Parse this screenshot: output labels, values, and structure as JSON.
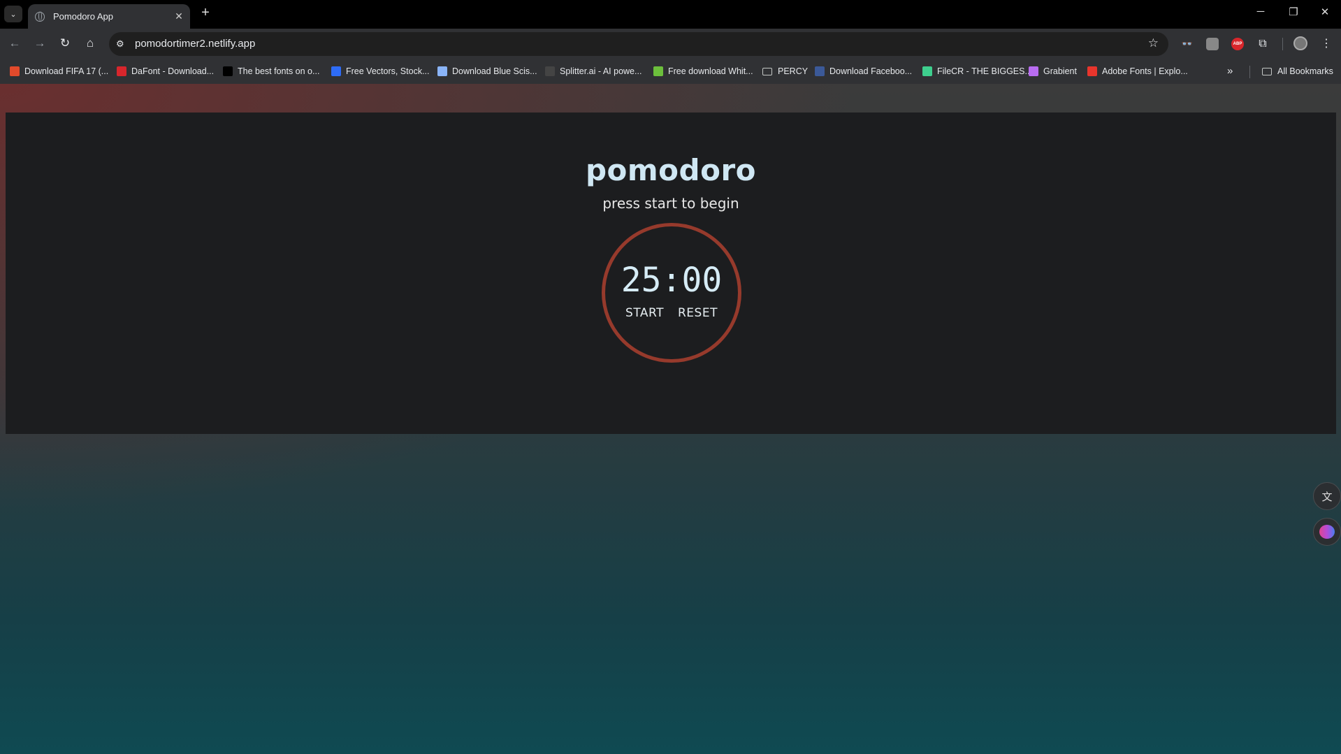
{
  "browser": {
    "tab_title": "Pomodoro App",
    "url": "pomodortimer2.netlify.app",
    "bookmarks": [
      {
        "label": "Download FIFA 17 (...",
        "icon": "x-icon",
        "color": "#e24a2b"
      },
      {
        "label": "DaFont - Download...",
        "icon": "dafont-icon",
        "color": "#d7262c"
      },
      {
        "label": "The best fonts on o...",
        "icon": "font-a-icon",
        "color": "#000000"
      },
      {
        "label": "Free Vectors, Stock...",
        "icon": "freepik-icon",
        "color": "#2e6cf6"
      },
      {
        "label": "Download Blue Scis...",
        "icon": "scissors-icon",
        "color": "#8ab4f8"
      },
      {
        "label": "Splitter.ai - AI powe...",
        "icon": "splitter-icon",
        "color": "#444444"
      },
      {
        "label": "Free download Whit...",
        "icon": "leaf-icon",
        "color": "#6cbf3c"
      },
      {
        "label": "PERCY",
        "icon": "folder-icon",
        "color": "#c4c7c5"
      },
      {
        "label": "Download Faceboo...",
        "icon": "facebook-icon",
        "color": "#3b5998"
      },
      {
        "label": "FileCR - THE BIGGES...",
        "icon": "filecr-icon",
        "color": "#3ecf8e"
      },
      {
        "label": "Grabient",
        "icon": "grabient-icon",
        "color": "#b86cf0"
      },
      {
        "label": "Adobe Fonts | Explo...",
        "icon": "adobe-icon",
        "color": "#e8352c"
      }
    ],
    "all_bookmarks": "All Bookmarks"
  },
  "app": {
    "title": "pomodoro",
    "subtitle": "press start to begin",
    "time": "25:00",
    "start_label": "START",
    "reset_label": "RESET",
    "ring_color": "#963a2c"
  }
}
